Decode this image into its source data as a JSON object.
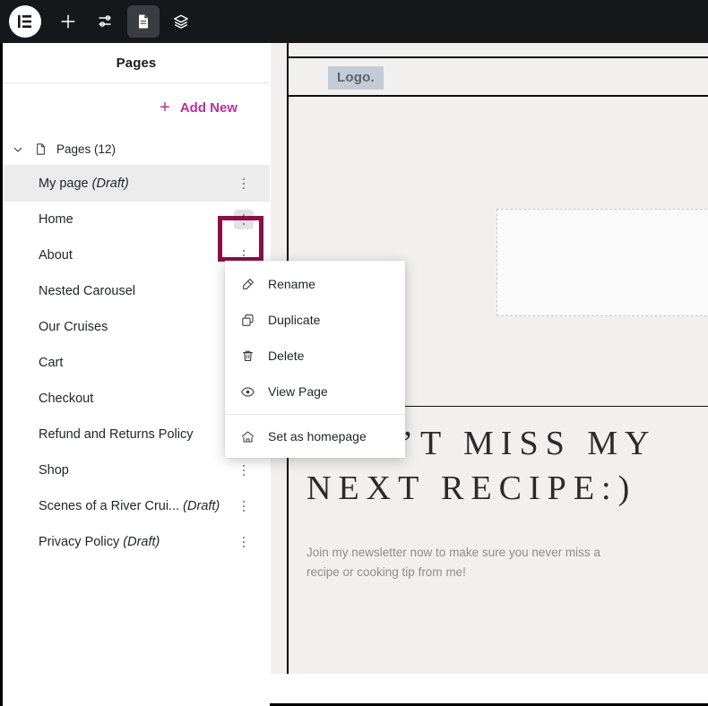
{
  "toolbar": {
    "logo_icon": "elementor-logo-icon",
    "items": [
      {
        "id": "add-element",
        "icon": "plus-icon",
        "active": false
      },
      {
        "id": "site-settings",
        "icon": "sliders-icon",
        "active": false
      },
      {
        "id": "pages",
        "icon": "document-icon",
        "active": true
      },
      {
        "id": "structure",
        "icon": "layers-icon",
        "active": false
      }
    ]
  },
  "sidebar": {
    "title": "Pages",
    "add_new_label": "Add New",
    "add_new_icon": "plus-icon",
    "group": {
      "label": "Pages (12)",
      "chevron_icon": "chevron-down-icon",
      "doc_icon": "document-icon",
      "expanded": true
    },
    "pages": [
      {
        "name": "My page",
        "status": "(Draft)",
        "selected": true,
        "kebab_highlighted": false
      },
      {
        "name": "Home",
        "status": "",
        "selected": false,
        "kebab_highlighted": true
      },
      {
        "name": "About",
        "status": "",
        "selected": false,
        "kebab_highlighted": false
      },
      {
        "name": "Nested Carousel",
        "status": "",
        "selected": false,
        "kebab_highlighted": false
      },
      {
        "name": "Our Cruises",
        "status": "",
        "selected": false,
        "kebab_highlighted": false
      },
      {
        "name": "Cart",
        "status": "",
        "selected": false,
        "kebab_highlighted": false
      },
      {
        "name": "Checkout",
        "status": "",
        "selected": false,
        "kebab_highlighted": false
      },
      {
        "name": "Refund and Returns Policy",
        "status": "",
        "selected": false,
        "kebab_highlighted": false
      },
      {
        "name": "Shop",
        "status": "",
        "selected": false,
        "kebab_highlighted": false
      },
      {
        "name": "Scenes of a River Crui...",
        "status": "(Draft)",
        "selected": false,
        "kebab_highlighted": false
      },
      {
        "name": "Privacy Policy",
        "status": "(Draft)",
        "selected": false,
        "kebab_highlighted": false
      }
    ]
  },
  "context_menu": {
    "items": [
      {
        "label": "Rename",
        "icon": "eraser-icon"
      },
      {
        "label": "Duplicate",
        "icon": "copy-icon"
      },
      {
        "label": "Delete",
        "icon": "trash-icon"
      },
      {
        "label": "View Page",
        "icon": "eye-icon"
      },
      {
        "label": "Set as homepage",
        "icon": "home-icon"
      }
    ],
    "separator_after_index": 3
  },
  "preview": {
    "logo_text": "Logo.",
    "heading": "DON’T MISS MY NEXT RECIPE:)",
    "subtext": "Join my newsletter now to make sure you never miss a recipe or cooking tip from me!"
  },
  "colors": {
    "accent_pink": "#b5339a",
    "highlight_ring": "#8c0e46",
    "toolbar_bg": "#15171a",
    "canvas_bg": "#f1f0ee",
    "logo_badge_bg": "#c3ccd6"
  }
}
